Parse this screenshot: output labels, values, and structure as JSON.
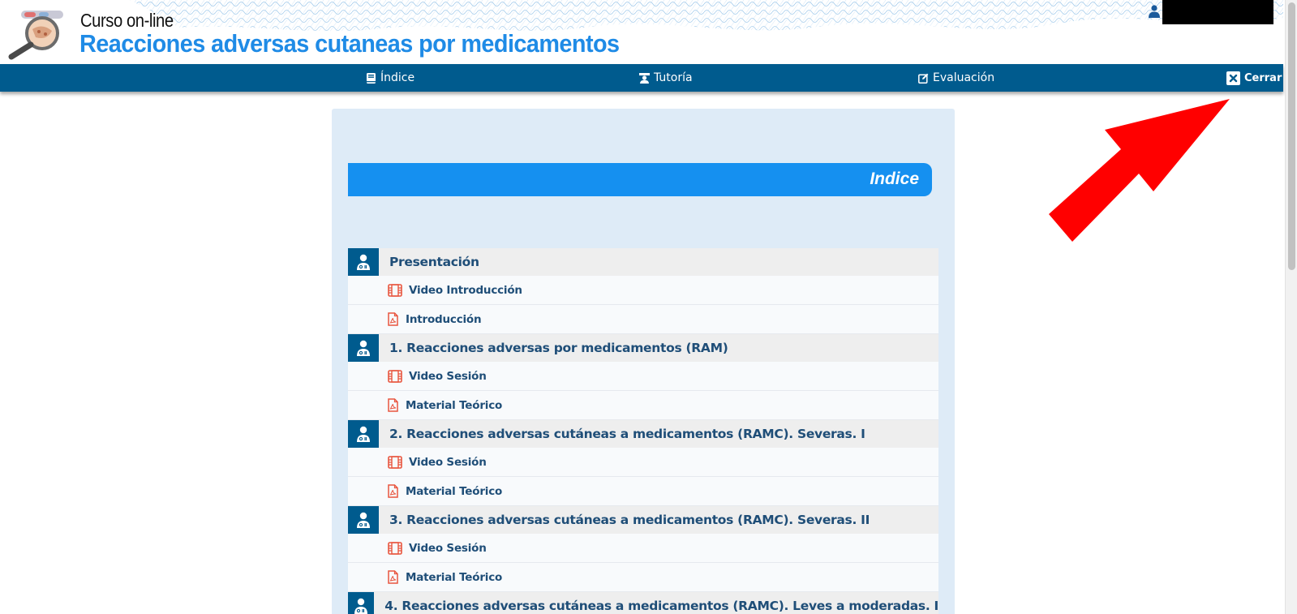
{
  "header": {
    "course_label": "Curso on-line",
    "course_title": "Reacciones adversas cutaneas por medicamentos",
    "title_color": "#1f8be6"
  },
  "nav": {
    "indice": "Índice",
    "tutoria": "Tutoría",
    "evaluacion": "Evaluación",
    "cerrar": "Cerrar",
    "bar_color": "#005b8e"
  },
  "index": {
    "title": "Indice",
    "sections": [
      {
        "label": "Presentación",
        "items": [
          {
            "type": "video",
            "label": "Video Introducción"
          },
          {
            "type": "pdf",
            "label": "Introducción"
          }
        ]
      },
      {
        "label": "1. Reacciones adversas por medicamentos (RAM)",
        "items": [
          {
            "type": "video",
            "label": "Video Sesión"
          },
          {
            "type": "pdf",
            "label": "Material Teórico"
          }
        ]
      },
      {
        "label": "2. Reacciones adversas cutáneas a medicamentos (RAMC). Severas. I",
        "items": [
          {
            "type": "video",
            "label": "Video Sesión"
          },
          {
            "type": "pdf",
            "label": "Material Teórico"
          }
        ]
      },
      {
        "label": "3. Reacciones adversas cutáneas a medicamentos (RAMC). Severas. II",
        "items": [
          {
            "type": "video",
            "label": "Video Sesión"
          },
          {
            "type": "pdf",
            "label": "Material Teórico"
          }
        ]
      },
      {
        "label": "4. Reacciones adversas cutáneas a medicamentos (RAMC). Leves a moderadas. I",
        "items": []
      }
    ]
  },
  "colors": {
    "accent": "#1590f0",
    "dark_blue": "#005b8e",
    "icon_orange": "#e8553e",
    "arrow": "#ff0000"
  }
}
